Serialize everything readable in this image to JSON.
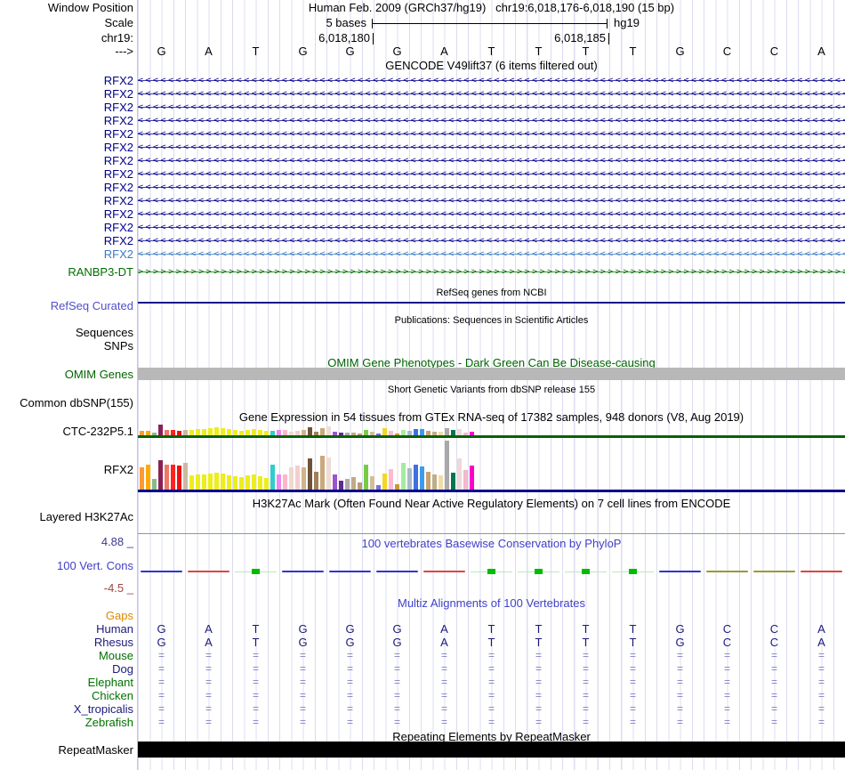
{
  "ruler": {
    "window_label": "Window Position",
    "assembly_title": "Human Feb. 2009 (GRCh37/hg19)",
    "position_title": "chr19:6,018,176-6,018,190 (15 bp)",
    "scale_label": "Scale",
    "scale_value": "5 bases",
    "genome": "hg19",
    "chrom_label": "chr19:",
    "tick_labels": [
      "6,018,180",
      "6,018,185"
    ],
    "strand_label": "--->",
    "sequence": [
      "G",
      "A",
      "T",
      "G",
      "G",
      "G",
      "A",
      "T",
      "T",
      "T",
      "T",
      "G",
      "C",
      "C",
      "A"
    ]
  },
  "tracks": {
    "gencode": {
      "title": "GENCODE V49lift37 (6 items filtered out)",
      "genes": [
        {
          "label": "RFX2",
          "color": "#00008b",
          "arrow": "<"
        },
        {
          "label": "RFX2",
          "color": "#00008b",
          "arrow": "<"
        },
        {
          "label": "RFX2",
          "color": "#00008b",
          "arrow": "<"
        },
        {
          "label": "RFX2",
          "color": "#00008b",
          "arrow": "<"
        },
        {
          "label": "RFX2",
          "color": "#00008b",
          "arrow": "<"
        },
        {
          "label": "RFX2",
          "color": "#00008b",
          "arrow": "<"
        },
        {
          "label": "RFX2",
          "color": "#00008b",
          "arrow": "<"
        },
        {
          "label": "RFX2",
          "color": "#00008b",
          "arrow": "<"
        },
        {
          "label": "RFX2",
          "color": "#00008b",
          "arrow": "<"
        },
        {
          "label": "RFX2",
          "color": "#00008b",
          "arrow": "<"
        },
        {
          "label": "RFX2",
          "color": "#00008b",
          "arrow": "<"
        },
        {
          "label": "RFX2",
          "color": "#00008b",
          "arrow": "<"
        },
        {
          "label": "RFX2",
          "color": "#00008b",
          "arrow": "<"
        },
        {
          "label": "RFX2",
          "color": "#3b7bbf",
          "arrow": "<"
        },
        {
          "label": "RANBP3-DT",
          "color": "#006e00",
          "arrow": ">"
        }
      ]
    },
    "refseq": {
      "title": "RefSeq genes from NCBI",
      "label": "RefSeq Curated",
      "label_color": "#5050c8",
      "line_color": "#14148c"
    },
    "publications": {
      "title": "Publications: Sequences in Scientific Articles",
      "labels": [
        "Sequences",
        "SNPs"
      ]
    },
    "omim": {
      "title": "OMIM Gene Phenotypes - Dark Green Can Be Disease-causing",
      "title_color": "#006400",
      "label": "OMIM Genes",
      "label_color": "#006400",
      "bar_color": "#b8b8b8"
    },
    "dbsnp": {
      "title": "Short Genetic Variants from dbSNP release 155",
      "label": "Common dbSNP(155)"
    },
    "gtex": {
      "title": "Gene Expression in 54 tissues from GTEx RNA-seq of 17382 samples, 948 donors (V8, Aug 2019)",
      "chart_data": {
        "type": "bar",
        "tissue_colors": [
          "#ff9933",
          "#ffaa00",
          "#88bb88",
          "#882255",
          "#ee7766",
          "#ff2222",
          "#ee1111",
          "#ccb9a4",
          "#eded1f",
          "#eded1f",
          "#eded1f",
          "#eded1f",
          "#eded1f",
          "#eded1f",
          "#eded1f",
          "#eded1f",
          "#eded1f",
          "#eded1f",
          "#eded1f",
          "#eded1f",
          "#eded1f",
          "#33cccc",
          "#ee88ee",
          "#ffb6c8",
          "#f0d8d0",
          "#f2cfcf",
          "#d2b48c",
          "#6e5239",
          "#a28057",
          "#c9a87e",
          "#eedcd4",
          "#9a55cc",
          "#5c2d91",
          "#b3aba1",
          "#c2a987",
          "#bb9977",
          "#77cc44",
          "#cfbf9b",
          "#7a6fdd",
          "#f2d723",
          "#ffb9d2",
          "#c99a33",
          "#a5eca0",
          "#a9b9c9",
          "#3f6fe0",
          "#3d9bef",
          "#c7a271",
          "#bfae89",
          "#f0dcaa",
          "#a9a9a9",
          "#00784b",
          "#eed9d9",
          "#f2b9ca",
          "#ff00cc"
        ],
        "series": [
          {
            "name": "CTC-232P5.1",
            "baseline_color": "#006400",
            "heights": [
              5,
              5,
              3,
              12,
              6,
              6,
              5,
              6,
              6,
              7,
              7,
              8,
              9,
              8,
              7,
              6,
              5,
              6,
              7,
              6,
              5,
              5,
              6,
              6,
              4,
              5,
              6,
              9,
              4,
              8,
              10,
              4,
              3,
              3,
              3,
              2,
              6,
              4,
              2,
              8,
              5,
              2,
              6,
              5,
              7,
              7,
              5,
              4,
              4,
              8,
              6,
              7,
              3,
              4
            ]
          },
          {
            "name": "RFX2",
            "baseline_color": "#00008b",
            "heights": [
              25,
              28,
              12,
              33,
              28,
              28,
              27,
              30,
              16,
              17,
              17,
              18,
              19,
              18,
              16,
              15,
              14,
              16,
              17,
              15,
              13,
              28,
              17,
              17,
              25,
              27,
              25,
              35,
              20,
              38,
              36,
              17,
              10,
              12,
              14,
              8,
              28,
              15,
              5,
              18,
              23,
              6,
              30,
              24,
              28,
              26,
              20,
              17,
              16,
              55,
              19,
              35,
              22,
              27
            ]
          }
        ]
      }
    },
    "h3k27ac": {
      "title": "H3K27Ac Mark (Often Found Near Active Regulatory Elements) on 7 cell lines from ENCODE",
      "label": "Layered H3K27Ac",
      "line_color": "#79a879"
    },
    "phylop": {
      "title": "100 vertebrates Basewise Conservation by PhyloP",
      "title_color": "#4040c8",
      "label": "100 Vert. Cons",
      "label_color": "#4040c8",
      "max_label": "4.88 _",
      "min_label": "-4.5 _",
      "max_color": "#3b3b8f",
      "min_color": "#a04545",
      "wiggle": [
        "blue",
        "red",
        "green",
        "blue",
        "blue",
        "blue",
        "red",
        "green",
        "green",
        "green",
        "green",
        "blue",
        "olive",
        "olive",
        "red"
      ],
      "wiggle_colors": {
        "blue": "#3333cc",
        "red": "#dd4444",
        "olive": "#999933",
        "green": "#00bb00"
      }
    },
    "multiz": {
      "title": "Multiz Alignments of 100 Vertebrates",
      "title_color": "#4040c8",
      "eq_char": "=",
      "seq_color": "#1a1a7a",
      "rows": [
        {
          "label": "Gaps",
          "color": "#dd8800",
          "content": "none"
        },
        {
          "label": "Human",
          "color": "#1a1a7a",
          "content": "seq",
          "sequence": [
            "G",
            "A",
            "T",
            "G",
            "G",
            "G",
            "A",
            "T",
            "T",
            "T",
            "T",
            "G",
            "C",
            "C",
            "A"
          ]
        },
        {
          "label": "Rhesus",
          "color": "#1a1a7a",
          "content": "seq",
          "sequence": [
            "G",
            "A",
            "T",
            "G",
            "G",
            "G",
            "A",
            "T",
            "T",
            "T",
            "T",
            "G",
            "C",
            "C",
            "A"
          ]
        },
        {
          "label": "Mouse",
          "color": "#007200",
          "content": "eq"
        },
        {
          "label": "Dog",
          "color": "#1a1a7a",
          "content": "eq"
        },
        {
          "label": "Elephant",
          "color": "#007200",
          "content": "eq"
        },
        {
          "label": "Chicken",
          "color": "#007200",
          "content": "eq"
        },
        {
          "label": "X_tropicalis",
          "color": "#1a1a7a",
          "content": "eq"
        },
        {
          "label": "Zebrafish",
          "color": "#007200",
          "content": "eq"
        }
      ]
    },
    "repeatmasker": {
      "title": "Repeating Elements by RepeatMasker",
      "label": "RepeatMasker",
      "bar_color": "#000000"
    }
  }
}
